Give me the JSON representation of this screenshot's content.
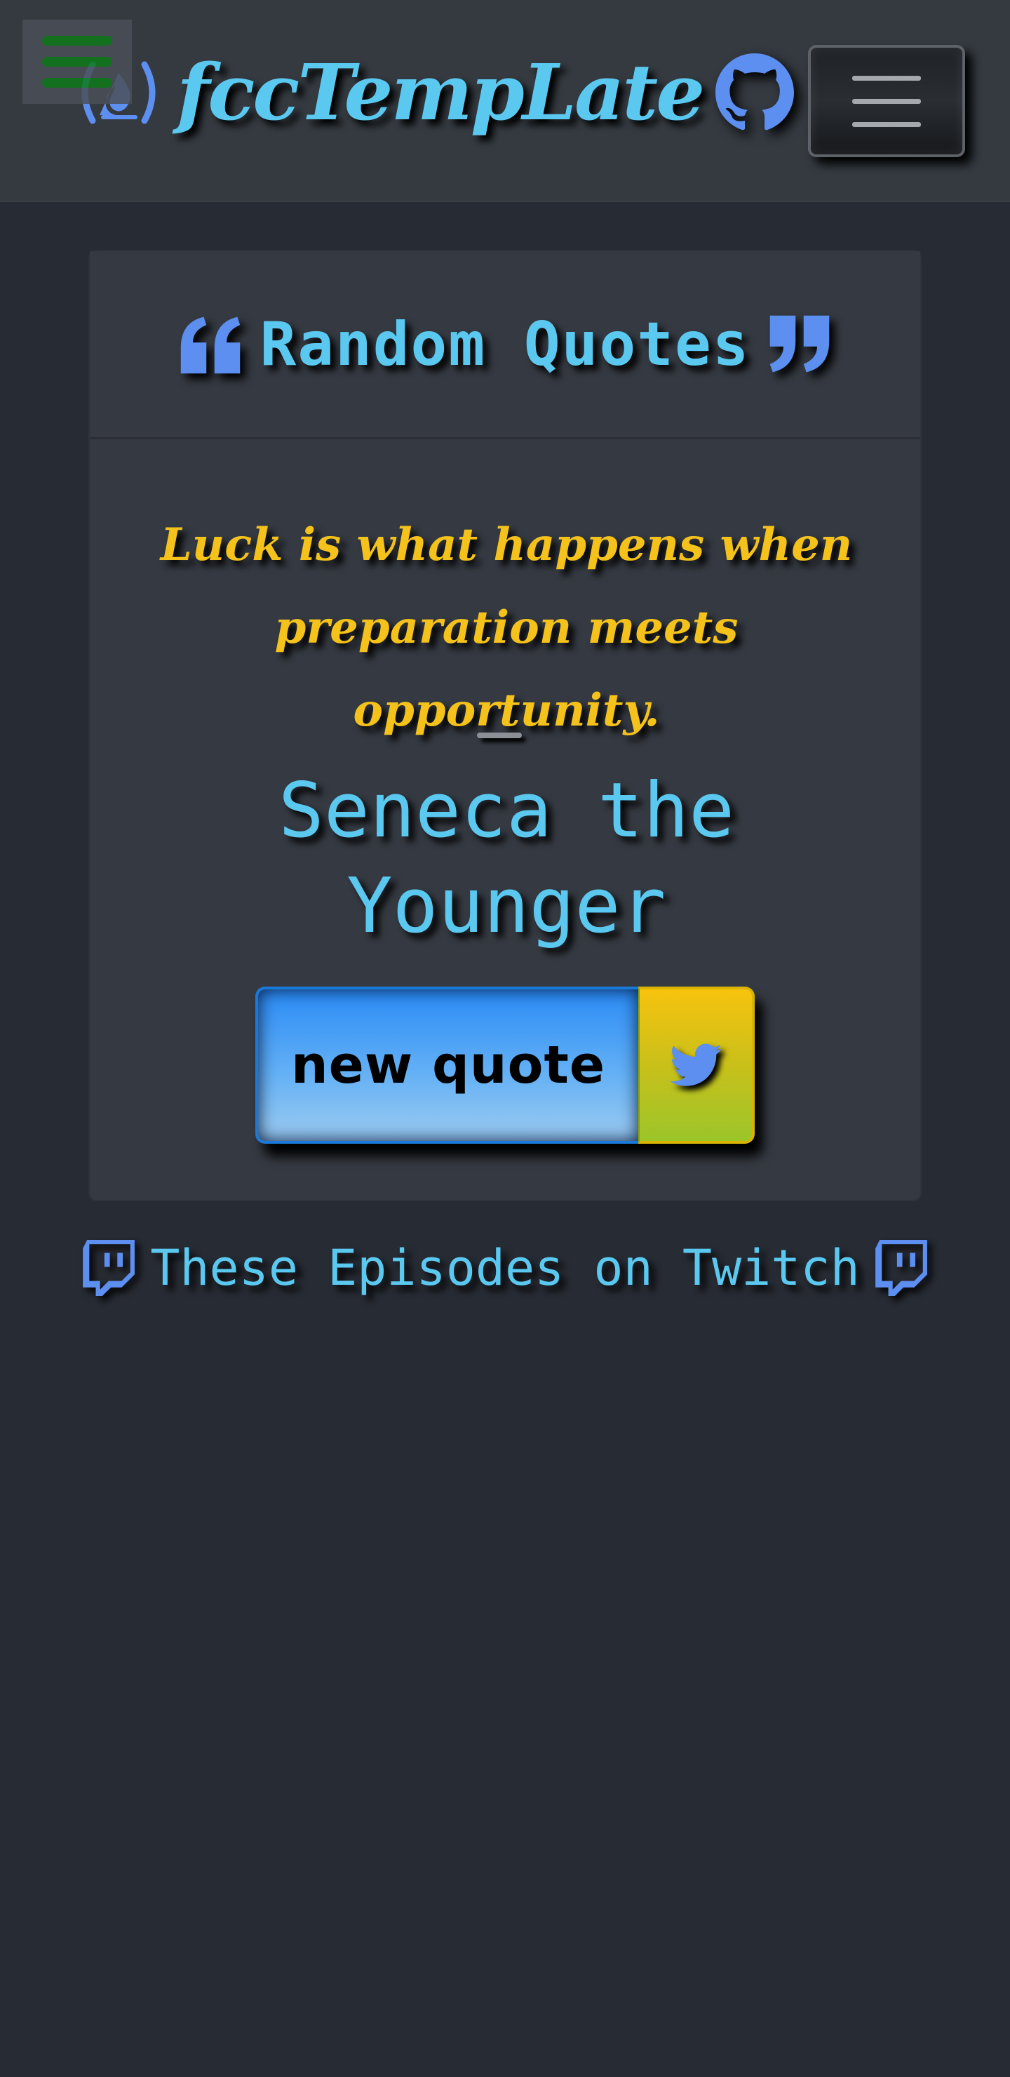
{
  "navbar": {
    "brand_text": "fccTempLate",
    "menu_icon": "hamburger-menu-icon",
    "brand_icon": "freecodecamp-icon",
    "github_icon": "github-icon",
    "toggler_icon": "navbar-toggler-icon"
  },
  "card": {
    "title": "Random Quotes",
    "open_quote_icon": "quote-left-icon",
    "close_quote_icon": "quote-right-icon",
    "quote": "Luck is what happens when preparation meets opportunity.",
    "author": "Seneca the Younger",
    "new_quote_label": "new quote",
    "tweet_icon": "twitter-icon"
  },
  "twitch": {
    "label": "These Episodes on Twitch",
    "icon": "twitch-icon"
  },
  "colors": {
    "page_bg": "#272b33",
    "navbar_bg": "#343a40",
    "card_bg": "#353a42",
    "accent_blue": "#5bc8f0",
    "icon_blue": "#5c8ff0",
    "quote_yellow": "#f5c21b",
    "menu_green": "#0e7a1a"
  }
}
